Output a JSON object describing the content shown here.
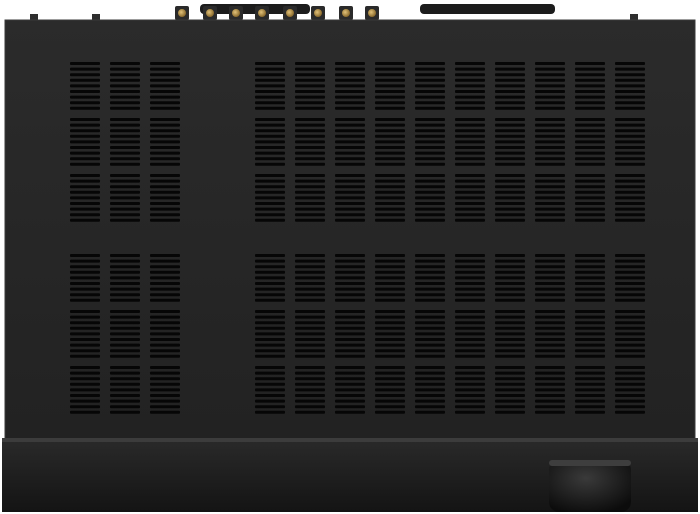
{
  "image": {
    "subject": "amplifier-top-view",
    "colors": {
      "background": "#ffffff",
      "chassis": "#262626",
      "chassis_edge": "#3a3a3a",
      "vent_slot": "#050505",
      "front_panel": "#1a1a1a",
      "terminal_gold": "#b08a3a",
      "antenna": "#1c1c1c"
    },
    "icons": [
      "wifi-antenna-icon",
      "bluetooth-antenna-icon",
      "speaker-terminal-icon",
      "volume-knob-icon"
    ]
  }
}
